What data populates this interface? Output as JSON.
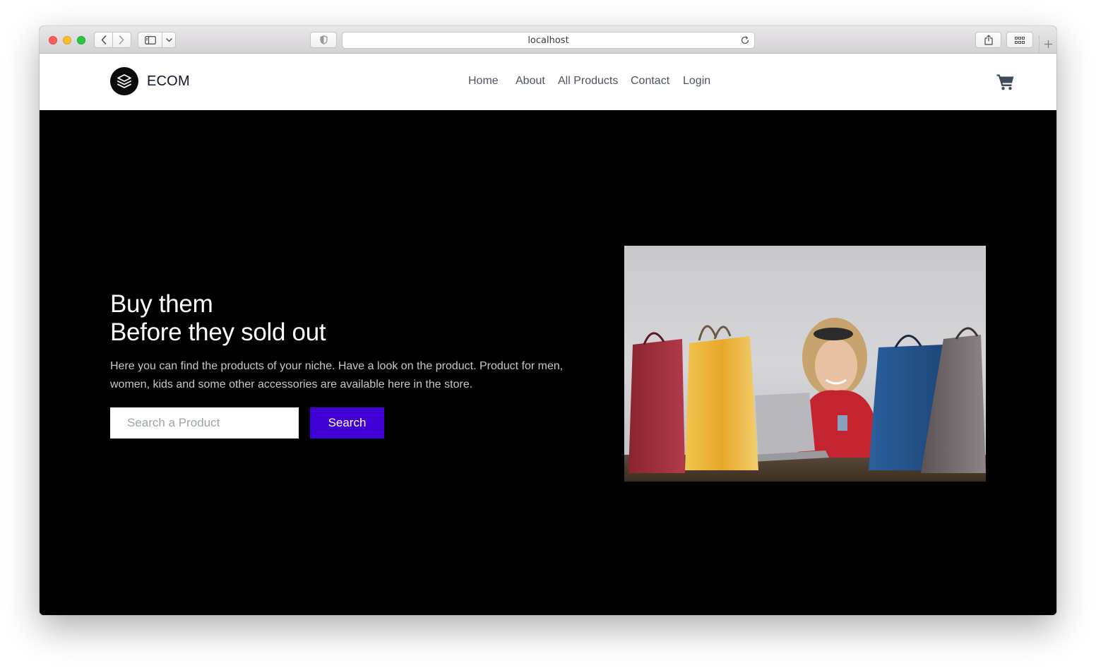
{
  "browser": {
    "url": "localhost",
    "colors": {
      "close": "#fe5f57",
      "minimize": "#febc2e",
      "zoom": "#28c840"
    },
    "icons": [
      "back-icon",
      "forward-icon",
      "sidebar-icon",
      "chevron-down-icon",
      "shield-icon",
      "reload-icon",
      "share-icon",
      "tab-overview-icon",
      "plus-icon"
    ]
  },
  "header": {
    "brand": "ECOM",
    "logo_icon": "layers-icon",
    "nav": [
      "Home",
      "About",
      "All Products",
      "Contact",
      "Login"
    ],
    "cart_icon": "cart-icon"
  },
  "hero": {
    "title_line1": "Buy them",
    "title_line2": "Before they sold out",
    "description": "Here you can find the products of your niche. Have a look on the product. Product for men, women, kids and some other accessories are available here in the store.",
    "search_placeholder": "Search a Product",
    "search_value": "",
    "search_button": "Search",
    "accent_color": "#3f00d6",
    "background_color": "#000000"
  }
}
